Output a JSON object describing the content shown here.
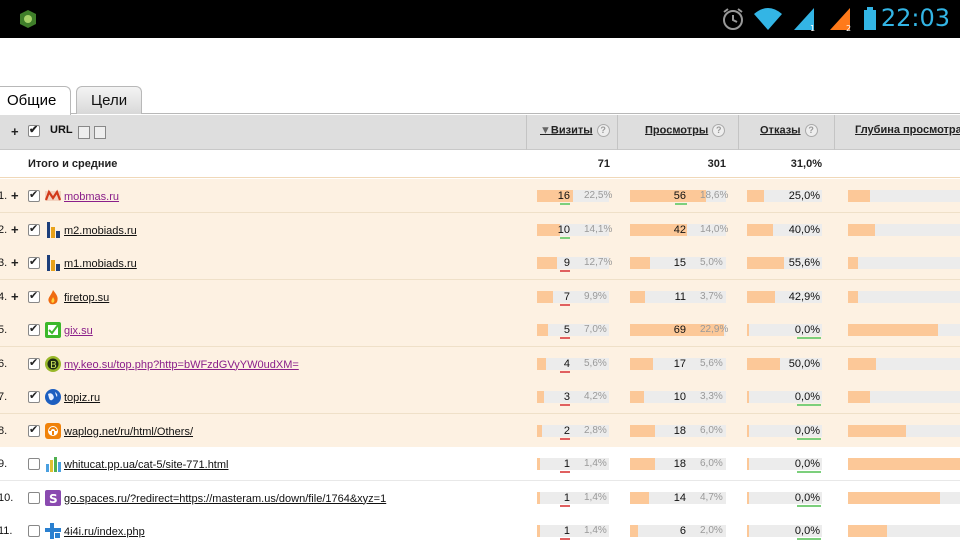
{
  "status_bar": {
    "time": "22:03"
  },
  "tabs": [
    {
      "label": "Общие"
    },
    {
      "label": "Цели"
    }
  ],
  "table": {
    "header": {
      "plus": "+",
      "url": "URL",
      "visits": "Визиты",
      "views": "Просмотры",
      "bounces": "Отказы",
      "depth": "Глубина просмотра",
      "help": "?"
    },
    "totals": {
      "label": "Итого и средние",
      "visits": "71",
      "views": "301",
      "bounces": "31,0%"
    },
    "rows": [
      {
        "num": "1.",
        "plus": "+",
        "checked": true,
        "icon": "mobmas-icon",
        "url": "mobmas.ru",
        "visited": true,
        "visits": "16",
        "visits_pct": "22,5%",
        "views": "56",
        "views_pct": "18,6%",
        "bounce": "25,0%",
        "depth_share": 0.2
      },
      {
        "num": "2.",
        "plus": "+",
        "checked": true,
        "icon": "mobiads-icon",
        "url": "m2.mobiads.ru",
        "visited": false,
        "visits": "10",
        "visits_pct": "14,1%",
        "views": "42",
        "views_pct": "14,0%",
        "bounce": "40,0%",
        "depth_share": 0.24
      },
      {
        "num": "3.",
        "plus": "+",
        "checked": true,
        "icon": "mobiads-icon",
        "url": "m1.mobiads.ru",
        "visited": false,
        "visits": "9",
        "visits_pct": "12,7%",
        "views": "15",
        "views_pct": "5,0%",
        "bounce": "55,6%",
        "depth_share": 0.09
      },
      {
        "num": "4.",
        "plus": "+",
        "checked": true,
        "icon": "firetop-icon",
        "url": "firetop.su",
        "visited": false,
        "visits": "7",
        "visits_pct": "9,9%",
        "views": "11",
        "views_pct": "3,7%",
        "bounce": "42,9%",
        "depth_share": 0.09
      },
      {
        "num": "5.",
        "plus": "",
        "checked": true,
        "icon": "gix-icon",
        "url": "gix.su",
        "visited": true,
        "visits": "5",
        "visits_pct": "7,0%",
        "views": "69",
        "views_pct": "22,9%",
        "bounce": "0,0%",
        "depth_share": 0.8
      },
      {
        "num": "6.",
        "plus": "",
        "checked": true,
        "icon": "keo-icon",
        "url": "my.keo.su/top.php?http=bWFzdGVyYW0udXM=",
        "visited": true,
        "visits": "4",
        "visits_pct": "5,6%",
        "views": "17",
        "views_pct": "5,6%",
        "bounce": "50,0%",
        "depth_share": 0.25
      },
      {
        "num": "7.",
        "plus": "",
        "checked": true,
        "icon": "globe-icon",
        "url": "topiz.ru",
        "visited": false,
        "visits": "3",
        "visits_pct": "4,2%",
        "views": "10",
        "views_pct": "3,3%",
        "bounce": "0,0%",
        "depth_share": 0.2
      },
      {
        "num": "8.",
        "plus": "",
        "checked": true,
        "icon": "waplog-icon",
        "url": "waplog.net/ru/html/Others/",
        "visited": false,
        "visits": "2",
        "visits_pct": "2,8%",
        "views": "18",
        "views_pct": "6,0%",
        "bounce": "0,0%",
        "depth_share": 0.52
      },
      {
        "num": "9.",
        "plus": "",
        "checked": false,
        "icon": "chart-icon",
        "url": "whitucat.pp.ua/cat-5/site-771.html",
        "visited": false,
        "visits": "1",
        "visits_pct": "1,4%",
        "views": "18",
        "views_pct": "6,0%",
        "bounce": "0,0%",
        "depth_share": 1.0
      },
      {
        "num": "10.",
        "plus": "",
        "checked": false,
        "icon": "spaces-icon",
        "url": "go.spaces.ru/?redirect=https://masteram.us/down/file/1764&xyz=1",
        "visited": false,
        "visits": "1",
        "visits_pct": "1,4%",
        "views": "14",
        "views_pct": "4,7%",
        "bounce": "0,0%",
        "depth_share": 0.82
      },
      {
        "num": "11.",
        "plus": "",
        "checked": false,
        "icon": "4i4i-icon",
        "url": "4i4i.ru/index.php",
        "visited": false,
        "visits": "1",
        "visits_pct": "1,4%",
        "views": "6",
        "views_pct": "2,0%",
        "bounce": "0,0%",
        "depth_share": 0.35
      }
    ]
  },
  "colors": {
    "bar": "#fcc898",
    "row_selected": "#fdf1e2",
    "accent": "#33b5e5",
    "good": "#7ccf7c",
    "bad": "#e06060"
  }
}
